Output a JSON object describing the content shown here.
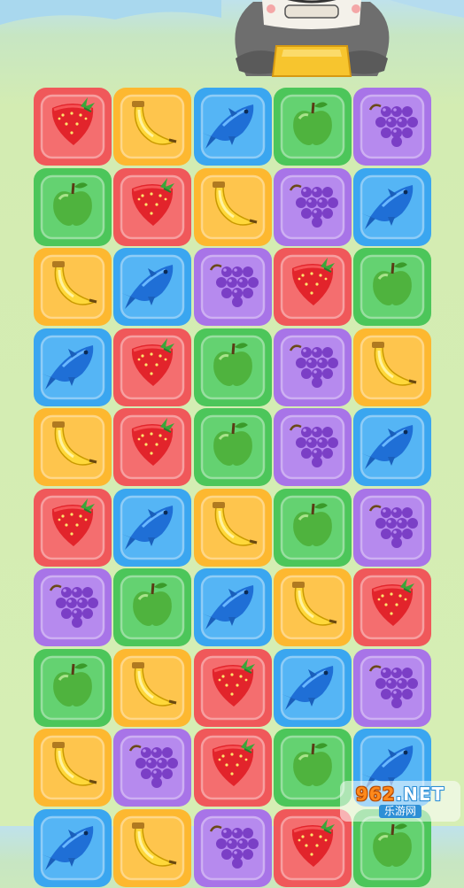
{
  "game": {
    "tile_types": {
      "strawberry": {
        "icon": "strawberry-icon",
        "color": "#f0585a",
        "light": "#f98081"
      },
      "banana": {
        "icon": "banana-icon",
        "color": "#fdb830",
        "light": "#ffd166"
      },
      "fish": {
        "icon": "fish-icon",
        "color": "#3aa6f0",
        "light": "#6cc2fa"
      },
      "apple": {
        "icon": "apple-icon",
        "color": "#4cc65a",
        "light": "#78dc84"
      },
      "grapes": {
        "icon": "grapes-icon",
        "color": "#a874e8",
        "light": "#c29cf3"
      }
    },
    "grid": [
      [
        "strawberry",
        "banana",
        "fish",
        "apple",
        "grapes"
      ],
      [
        "apple",
        "strawberry",
        "banana",
        "grapes",
        "fish"
      ],
      [
        "banana",
        "fish",
        "grapes",
        "strawberry",
        "apple"
      ],
      [
        "fish",
        "strawberry",
        "apple",
        "grapes",
        "banana"
      ],
      [
        "banana",
        "strawberry",
        "apple",
        "grapes",
        "fish"
      ],
      [
        "strawberry",
        "fish",
        "banana",
        "apple",
        "grapes"
      ],
      [
        "grapes",
        "apple",
        "fish",
        "banana",
        "strawberry"
      ],
      [
        "apple",
        "banana",
        "strawberry",
        "fish",
        "grapes"
      ],
      [
        "banana",
        "grapes",
        "strawberry",
        "apple",
        "fish"
      ],
      [
        "fish",
        "banana",
        "grapes",
        "strawberry",
        "apple"
      ]
    ]
  },
  "watermark": {
    "number": "962",
    "suffix": ".NET",
    "subtitle": "乐游网"
  }
}
